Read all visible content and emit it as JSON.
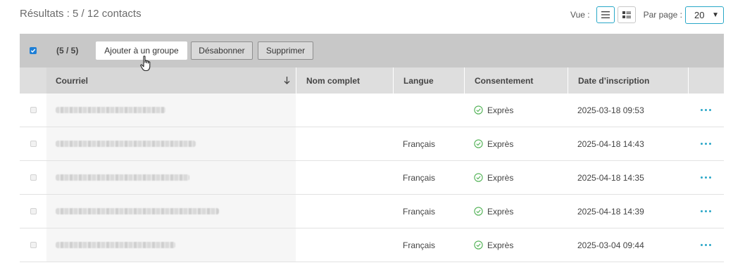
{
  "header": {
    "results_text": "Résultats : 5 / 12 contacts",
    "view_label": "Vue :",
    "view_modes": [
      "list-view-icon",
      "card-view-icon"
    ],
    "per_page_label": "Par page :",
    "per_page_value": "20"
  },
  "actionbar": {
    "selection_count": "(5 / 5)",
    "buttons": {
      "add_to_group": "Ajouter à un groupe",
      "unsubscribe": "Désabonner",
      "delete": "Supprimer"
    }
  },
  "table": {
    "columns": {
      "email": "Courriel",
      "name": "Nom complet",
      "language": "Langue",
      "consent": "Consentement",
      "signup_date": "Date d’inscription"
    },
    "rows": [
      {
        "name": "",
        "language": "",
        "consent": "Exprès",
        "signup_date": "2025-03-18 09:53"
      },
      {
        "name": "",
        "language": "Français",
        "consent": "Exprès",
        "signup_date": "2025-04-18 14:43"
      },
      {
        "name": "",
        "language": "Français",
        "consent": "Exprès",
        "signup_date": "2025-04-18 14:35"
      },
      {
        "name": "",
        "language": "Français",
        "consent": "Exprès",
        "signup_date": "2025-04-18 14:39"
      },
      {
        "name": "",
        "language": "Français",
        "consent": "Exprès",
        "signup_date": "2025-03-04 09:44"
      }
    ]
  },
  "colors": {
    "accent": "#29a8c8",
    "checkbox_blue": "#1e7fd6",
    "consent_green": "#4caf50",
    "toolbar_bg": "#c8c8c8",
    "header_bg": "#dedede"
  }
}
